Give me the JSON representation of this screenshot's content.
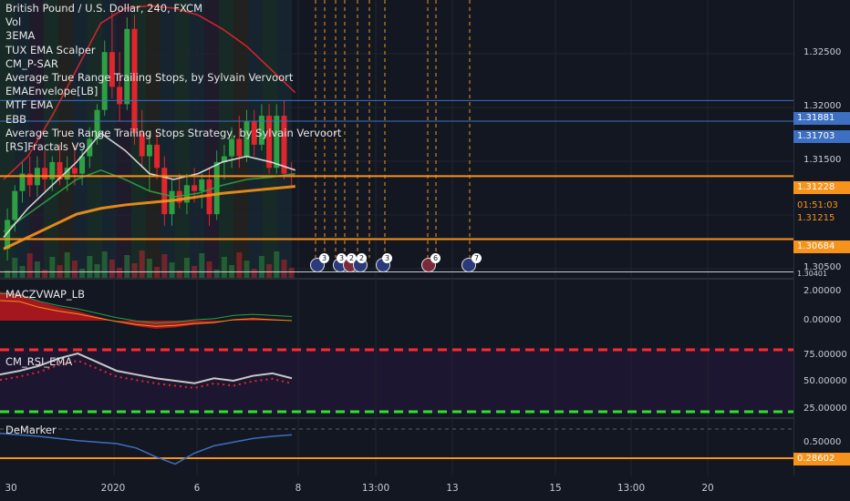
{
  "symbol_title": "British Pound / U.S. Dollar, 240, FXCM",
  "indicators": [
    "Vol",
    "3EMA",
    "TUX EMA Scalper",
    "CM_P-SAR",
    "Average True Range Trailing Stops, by Sylvain Vervoort",
    "EMAEnvelope[LB]",
    "MTF EMA",
    "EBB",
    "Average True Range Trailing Stops Strategy, by Sylvain Vervoort",
    "[RS]Fractals V9"
  ],
  "panes": {
    "macz": "MACZVWAP_LB",
    "rsi": "CM_RSI_EMA",
    "demarker": "DeMarker"
  },
  "price_axis": {
    "ticks": [
      "1.32500",
      "1.32000",
      "1.31500",
      "1.30500"
    ],
    "tags": [
      {
        "value": "1.31881",
        "color": "#3d6fc2"
      },
      {
        "value": "1.31703",
        "color": "#3d6fc2"
      },
      {
        "value": "1.31228",
        "color": "#f7931a"
      },
      {
        "value": "01:51:03",
        "color": "#f7931a"
      },
      {
        "value": "1.31215",
        "color": "#f7931a"
      },
      {
        "value": "1.30684",
        "color": "#f7931a"
      },
      {
        "value": "1.30401",
        "color": "#131722"
      }
    ]
  },
  "macz_axis": {
    "ticks": [
      "2.00000",
      "0.00000"
    ]
  },
  "rsi_axis": {
    "ticks": [
      "75.00000",
      "50.00000",
      "25.00000"
    ]
  },
  "dem_axis": {
    "ticks": [
      "0.50000"
    ],
    "tag": "0.28602",
    "tag_color": "#f7931a"
  },
  "x_axis": {
    "ticks": [
      {
        "label": "30"
      },
      {
        "label": "2020"
      },
      {
        "label": "6"
      },
      {
        "label": "8"
      },
      {
        "label": "13:00"
      },
      {
        "label": "13"
      },
      {
        "label": "15"
      },
      {
        "label": "13:00"
      },
      {
        "label": "20"
      }
    ]
  },
  "event_flags": [
    {
      "count": "3"
    },
    {
      "count": "3"
    },
    {
      "count": "2"
    },
    {
      "count": "2"
    },
    {
      "count": "3"
    },
    {
      "count": "6"
    },
    {
      "count": "7"
    }
  ],
  "colors": {
    "background": "#131722",
    "up_candle": "#2ea043",
    "down_candle": "#e0262c",
    "accent_orange": "#f7931a",
    "line_blue": "#3d6fc2",
    "rsi_overbought": "#ff2a2a",
    "rsi_oversold": "#2ee02e"
  },
  "chart_data": {
    "type": "line",
    "title": "British Pound / U.S. Dollar, 240, FXCM",
    "ylim": [
      1.3035,
      1.3275
    ],
    "candles": [
      [
        1.306,
        1.3095,
        1.305,
        1.3085
      ],
      [
        1.3085,
        1.3115,
        1.3075,
        1.311
      ],
      [
        1.311,
        1.3135,
        1.31,
        1.3125
      ],
      [
        1.3125,
        1.314,
        1.3105,
        1.3115
      ],
      [
        1.3115,
        1.314,
        1.3105,
        1.313
      ],
      [
        1.313,
        1.3145,
        1.311,
        1.312
      ],
      [
        1.312,
        1.314,
        1.311,
        1.3135
      ],
      [
        1.3135,
        1.315,
        1.3115,
        1.312
      ],
      [
        1.312,
        1.314,
        1.311,
        1.313
      ],
      [
        1.313,
        1.315,
        1.3115,
        1.3125
      ],
      [
        1.3125,
        1.3145,
        1.3115,
        1.314
      ],
      [
        1.314,
        1.3165,
        1.313,
        1.3155
      ],
      [
        1.3155,
        1.3185,
        1.315,
        1.318
      ],
      [
        1.318,
        1.324,
        1.3175,
        1.323
      ],
      [
        1.323,
        1.3265,
        1.319,
        1.32
      ],
      [
        1.32,
        1.323,
        1.317,
        1.3185
      ],
      [
        1.3185,
        1.326,
        1.318,
        1.325
      ],
      [
        1.325,
        1.3262,
        1.315,
        1.316
      ],
      [
        1.316,
        1.318,
        1.313,
        1.314
      ],
      [
        1.314,
        1.316,
        1.311,
        1.315
      ],
      [
        1.315,
        1.316,
        1.312,
        1.313
      ],
      [
        1.313,
        1.314,
        1.308,
        1.309
      ],
      [
        1.309,
        1.312,
        1.308,
        1.311
      ],
      [
        1.311,
        1.3125,
        1.3095,
        1.31
      ],
      [
        1.31,
        1.3125,
        1.309,
        1.3115
      ],
      [
        1.3115,
        1.313,
        1.31,
        1.311
      ],
      [
        1.311,
        1.3125,
        1.3095,
        1.312
      ],
      [
        1.312,
        1.313,
        1.308,
        1.309
      ],
      [
        1.309,
        1.3145,
        1.3085,
        1.3135
      ],
      [
        1.3135,
        1.315,
        1.312,
        1.314
      ],
      [
        1.314,
        1.3165,
        1.313,
        1.3155
      ],
      [
        1.3155,
        1.3175,
        1.313,
        1.314
      ],
      [
        1.314,
        1.318,
        1.3135,
        1.317
      ],
      [
        1.317,
        1.318,
        1.314,
        1.315
      ],
      [
        1.315,
        1.3185,
        1.3145,
        1.3175
      ],
      [
        1.3175,
        1.3185,
        1.3125,
        1.313
      ],
      [
        1.313,
        1.3185,
        1.3125,
        1.3175
      ],
      [
        1.3175,
        1.3188,
        1.312,
        1.3125
      ],
      [
        1.3125,
        1.3135,
        1.3115,
        1.3122
      ]
    ],
    "series": [
      {
        "name": "",
        "color": "#e0262c",
        "values": [
          1.312,
          1.314,
          1.3175,
          1.3215,
          1.3255,
          1.3268,
          1.327,
          1.3268,
          1.3262,
          1.325,
          1.3235,
          1.3215,
          1.3195
        ]
      },
      {
        "name": "",
        "color": "#f7931a",
        "values": [
          1.306,
          1.307,
          1.308,
          1.309,
          1.3095,
          1.3098,
          1.31,
          1.3102,
          1.3105,
          1.3108,
          1.311,
          1.3112,
          1.3114
        ]
      },
      {
        "name": "",
        "color": "#2ea043",
        "values": [
          1.3075,
          1.309,
          1.3105,
          1.312,
          1.3128,
          1.312,
          1.311,
          1.3105,
          1.3108,
          1.3115,
          1.312,
          1.3122,
          1.3125
        ]
      },
      {
        "name": "",
        "color": "#e6e6e6",
        "values": [
          1.307,
          1.3095,
          1.3115,
          1.3135,
          1.316,
          1.3145,
          1.3125,
          1.312,
          1.3125,
          1.3135,
          1.314,
          1.3135,
          1.3128
        ]
      }
    ]
  }
}
